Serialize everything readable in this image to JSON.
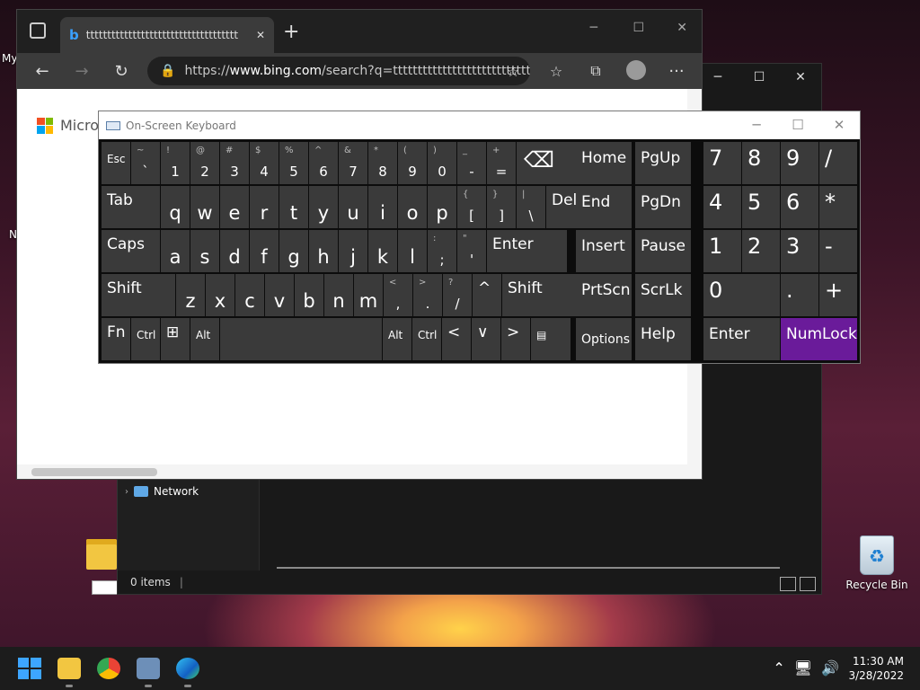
{
  "desktop": {
    "left_label": "My",
    "left_label2": "N",
    "recycle_bin": "Recycle Bin"
  },
  "explorer": {
    "nav_network": "Network",
    "status": "0 items",
    "controls": {
      "minimize": "─",
      "maximize": "☐",
      "close": "✕"
    }
  },
  "edge": {
    "tab_title": "tttttttttttttttttttttttttttttttttttt",
    "tab_close": "✕",
    "new_tab": "+",
    "address_prefix": "https://",
    "address_host": "www.bing.com",
    "address_path": "/search?q=tttttttttttttttttttttttttttt...",
    "page_logo": "Micros",
    "controls": {
      "minimize": "─",
      "maximize": "☐",
      "close": "✕"
    },
    "toolbar_more": "···"
  },
  "osk": {
    "title": "On-Screen Keyboard",
    "controls": {
      "minimize": "─",
      "maximize": "☐",
      "close": "✕"
    },
    "rows": [
      [
        {
          "main": "Esc",
          "kind": "small"
        },
        {
          "shift": "~",
          "low": "`"
        },
        {
          "shift": "!",
          "low": "1"
        },
        {
          "shift": "@",
          "low": "2"
        },
        {
          "shift": "#",
          "low": "3"
        },
        {
          "shift": "$",
          "low": "4"
        },
        {
          "shift": "%",
          "low": "5"
        },
        {
          "shift": "^",
          "low": "6"
        },
        {
          "shift": "&",
          "low": "7"
        },
        {
          "shift": "*",
          "low": "8"
        },
        {
          "shift": "(",
          "low": "9"
        },
        {
          "shift": ")",
          "low": "0"
        },
        {
          "shift": "_",
          "low": "-"
        },
        {
          "shift": "+",
          "low": "="
        },
        {
          "main": "⌫",
          "kind": "big"
        }
      ],
      [
        {
          "main": "Tab"
        },
        {
          "main": "q"
        },
        {
          "main": "w"
        },
        {
          "main": "e"
        },
        {
          "main": "r"
        },
        {
          "main": "t"
        },
        {
          "main": "y"
        },
        {
          "main": "u"
        },
        {
          "main": "i"
        },
        {
          "main": "o"
        },
        {
          "main": "p"
        },
        {
          "shift": "{",
          "low": "["
        },
        {
          "shift": "}",
          "low": "]"
        },
        {
          "shift": "|",
          "low": "\\"
        },
        {
          "main": "Del"
        }
      ],
      [
        {
          "main": "Caps"
        },
        {
          "main": "a"
        },
        {
          "main": "s"
        },
        {
          "main": "d"
        },
        {
          "main": "f"
        },
        {
          "main": "g"
        },
        {
          "main": "h"
        },
        {
          "main": "j"
        },
        {
          "main": "k"
        },
        {
          "main": "l"
        },
        {
          "shift": ":",
          "low": ";"
        },
        {
          "shift": "\"",
          "low": "'"
        },
        {
          "main": "Enter"
        }
      ],
      [
        {
          "main": "Shift"
        },
        {
          "main": "z"
        },
        {
          "main": "x"
        },
        {
          "main": "c"
        },
        {
          "main": "v"
        },
        {
          "main": "b"
        },
        {
          "main": "n"
        },
        {
          "main": "m"
        },
        {
          "shift": "<",
          "low": ","
        },
        {
          "shift": ">",
          "low": "."
        },
        {
          "shift": "?",
          "low": "/"
        },
        {
          "main": "^"
        },
        {
          "main": "Shift"
        }
      ],
      [
        {
          "main": "Fn"
        },
        {
          "main": "Ctrl",
          "kind": "small"
        },
        {
          "main": "⊞"
        },
        {
          "main": "Alt",
          "kind": "small"
        },
        {
          "main": ""
        },
        {
          "main": "Alt",
          "kind": "small"
        },
        {
          "main": "Ctrl",
          "kind": "small"
        },
        {
          "main": "<"
        },
        {
          "main": "∨"
        },
        {
          "main": ">"
        },
        {
          "main": "▤",
          "kind": "small"
        }
      ]
    ],
    "nav_keys": [
      "Home",
      "PgUp",
      "End",
      "PgDn",
      "Insert",
      "Pause",
      "PrtScn",
      "ScrLk",
      "Options",
      "Help"
    ],
    "numpad": [
      "7",
      "8",
      "9",
      "/",
      "4",
      "5",
      "6",
      "*",
      "1",
      "2",
      "3",
      "-",
      "0",
      ".",
      "+",
      "Enter",
      "NumLock"
    ],
    "numlock_color": "#6a1b9a"
  },
  "taskbar": {
    "time": "11:30 AM",
    "date": "3/28/2022"
  }
}
